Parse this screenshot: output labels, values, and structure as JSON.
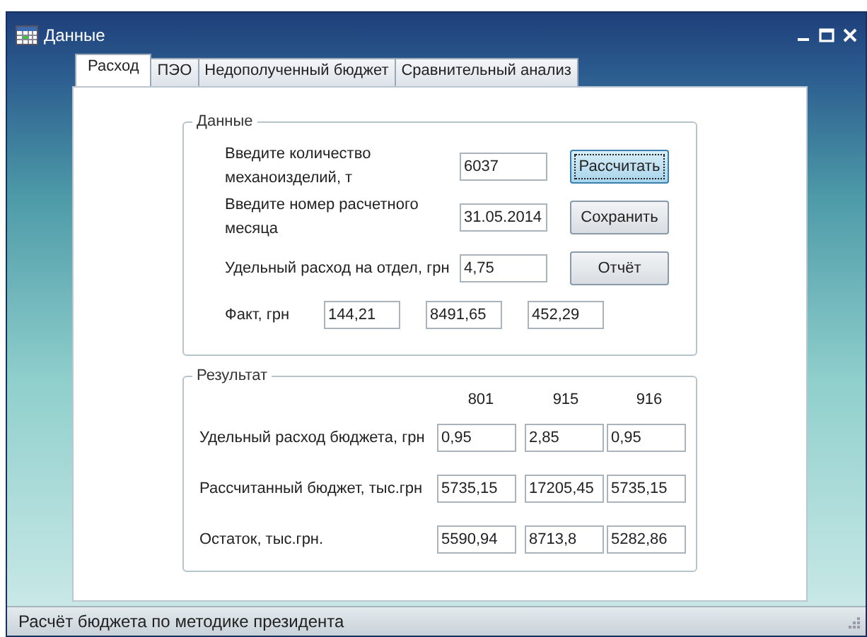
{
  "window": {
    "title": "Данные"
  },
  "tabs": [
    {
      "label": "Расход",
      "selected": true
    },
    {
      "label": "ПЭО",
      "selected": false
    },
    {
      "label": "Недополученный бюджет",
      "selected": false
    },
    {
      "label": "Сравнительный анализ",
      "selected": false
    }
  ],
  "input_group": {
    "title": "Данные",
    "rows": [
      {
        "label": "Введите количество механоизделий, т",
        "value": "6037",
        "button": {
          "label": "Рассчитать",
          "focused": true
        }
      },
      {
        "label": "Введите номер расчетного месяца",
        "value": "31.05.2014",
        "button": {
          "label": "Сохранить",
          "focused": false
        }
      },
      {
        "label": "Удельный расход на отдел, грн",
        "value": "4,75",
        "button": {
          "label": "Отчёт",
          "focused": false
        }
      }
    ],
    "fact": {
      "label": "Факт, грн",
      "values": [
        "144,21",
        "8491,65",
        "452,29"
      ]
    }
  },
  "result_group": {
    "title": "Результат",
    "columns": [
      "801",
      "915",
      "916"
    ],
    "rows": [
      {
        "label": "Удельный расход бюджета, грн",
        "values": [
          "0,95",
          "2,85",
          "0,95"
        ]
      },
      {
        "label": "Рассчитанный бюджет, тыс.грн",
        "values": [
          "5735,15",
          "17205,45",
          "5735,15"
        ]
      },
      {
        "label": "Остаток, тыс.грн.",
        "values": [
          "5590,94",
          "8713,8",
          "5282,86"
        ]
      }
    ]
  },
  "status_bar": {
    "text": "Расчёт бюджета по методике президента"
  }
}
